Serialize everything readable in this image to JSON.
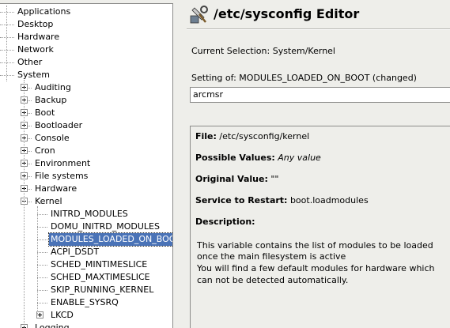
{
  "tree": {
    "top_items": [
      "Applications",
      "Desktop",
      "Hardware",
      "Network",
      "Other",
      "System"
    ],
    "system_children": [
      "Auditing",
      "Backup",
      "Boot",
      "Bootloader",
      "Console",
      "Cron",
      "Environment",
      "File systems",
      "Hardware",
      "Kernel"
    ],
    "kernel_children": [
      "INITRD_MODULES",
      "DOMU_INITRD_MODULES",
      "MODULES_LOADED_ON_BOOT",
      "ACPI_DSDT",
      "SCHED_MINTIMESLICE",
      "SCHED_MAXTIMESLICE",
      "SKIP_RUNNING_KERNEL",
      "ENABLE_SYSRQ",
      "LKCD"
    ],
    "after_kernel": "Logging",
    "selected": "MODULES_LOADED_ON_BOOT"
  },
  "editor": {
    "title": "/etc/sysconfig Editor",
    "current_selection": "Current Selection: System/Kernel",
    "setting_label": "Setting of: MODULES_LOADED_ON_BOOT  (changed)",
    "setting_value": "arcmsr"
  },
  "info": {
    "file_label": "File:",
    "file_value": "/etc/sysconfig/kernel",
    "possible_label": "Possible Values:",
    "possible_value": "Any value",
    "original_label": "Original Value:",
    "original_value": "\"\"",
    "service_label": "Service to Restart:",
    "service_value": "boot.loadmodules",
    "description_label": "Description:",
    "description_lines": [
      "This variable contains the list of modules to be loaded",
      "once the main filesystem is active",
      "You will find a few default modules for hardware which",
      "can not be detected automatically."
    ]
  }
}
